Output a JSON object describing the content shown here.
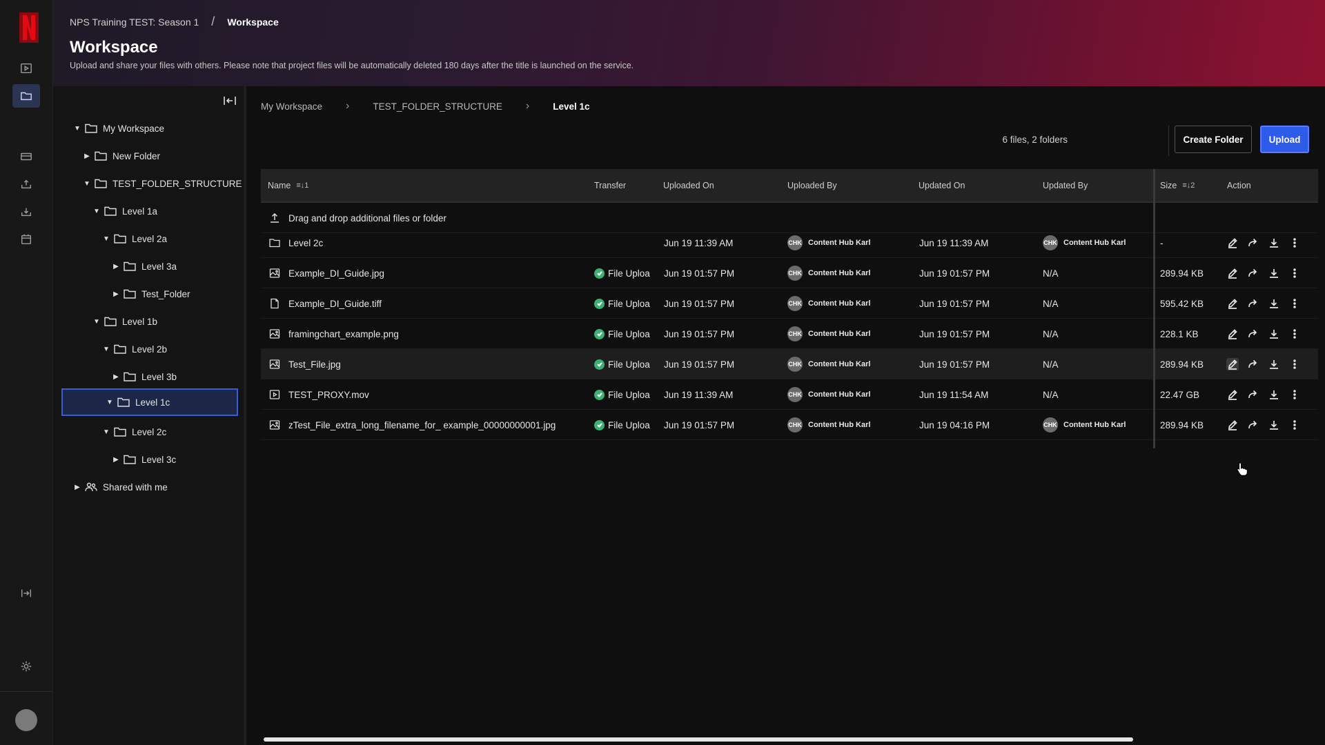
{
  "header": {
    "breadcrumb": [
      "NPS Training TEST: Season 1",
      "Workspace"
    ],
    "separator": "/",
    "title": "Workspace",
    "subtitle": "Upload and share your files with others. Please note that project files will be automatically deleted 180 days after the title is launched on the service."
  },
  "tree": {
    "items": [
      {
        "label": "My Workspace"
      },
      {
        "label": "New Folder"
      },
      {
        "label": "TEST_FOLDER_STRUCTURE"
      },
      {
        "label": "Level 1a"
      },
      {
        "label": "Level 2a"
      },
      {
        "label": "Level 3a"
      },
      {
        "label": "Test_Folder"
      },
      {
        "label": "Level 1b"
      },
      {
        "label": "Level 2b"
      },
      {
        "label": "Level 3b"
      },
      {
        "label": "Level 1c"
      },
      {
        "label": "Level 2c"
      },
      {
        "label": "Level 3c"
      },
      {
        "label": "Shared with me"
      }
    ]
  },
  "breadcrumb": [
    "My Workspace",
    "TEST_FOLDER_STRUCTURE",
    "Level 1c"
  ],
  "toolbar": {
    "counts": "6 files, 2 folders",
    "create_folder": "Create Folder",
    "upload": "Upload"
  },
  "table": {
    "columns": {
      "name": "Name",
      "name_sort": "1",
      "transfer": "Transfer",
      "uploaded_on": "Uploaded On",
      "uploaded_by": "Uploaded By",
      "updated_on": "Updated On",
      "updated_by": "Updated By",
      "size": "Size",
      "size_sort": "2",
      "action": "Action"
    },
    "dropzone": "Drag and drop additional files or folder",
    "user_initials": "CHK",
    "rows": [
      {
        "name": "Level 2c",
        "icon": "folder-icon",
        "transfer": "",
        "uploaded_on": "Jun 19 11:39 AM",
        "uploaded_by": "Content Hub Karl",
        "updated_on": "Jun 19 11:39 AM",
        "updated_by": "Content Hub Karl",
        "size": "-"
      },
      {
        "name": "Example_DI_Guide.jpg",
        "icon": "image-icon",
        "transfer": "File Uploa",
        "uploaded_on": "Jun 19 01:57 PM",
        "uploaded_by": "Content Hub Karl",
        "updated_on": "Jun 19 01:57 PM",
        "updated_by": "N/A",
        "size": "289.94 KB"
      },
      {
        "name": "Example_DI_Guide.tiff",
        "icon": "file-icon",
        "transfer": "File Uploa",
        "uploaded_on": "Jun 19 01:57 PM",
        "uploaded_by": "Content Hub Karl",
        "updated_on": "Jun 19 01:57 PM",
        "updated_by": "N/A",
        "size": "595.42 KB"
      },
      {
        "name": "framingchart_example.png",
        "icon": "image-icon",
        "transfer": "File Uploa",
        "uploaded_on": "Jun 19 01:57 PM",
        "uploaded_by": "Content Hub Karl",
        "updated_on": "Jun 19 01:57 PM",
        "updated_by": "N/A",
        "size": "228.1 KB"
      },
      {
        "name": "Test_File.jpg",
        "icon": "image-icon",
        "transfer": "File Uploa",
        "uploaded_on": "Jun 19 01:57 PM",
        "uploaded_by": "Content Hub Karl",
        "updated_on": "Jun 19 01:57 PM",
        "updated_by": "N/A",
        "size": "289.94 KB"
      },
      {
        "name": "TEST_PROXY.mov",
        "icon": "video-icon",
        "transfer": "File Uploa",
        "uploaded_on": "Jun 19 11:39 AM",
        "uploaded_by": "Content Hub Karl",
        "updated_on": "Jun 19 11:54 AM",
        "updated_by": "N/A",
        "size": "22.47 GB"
      },
      {
        "name": "zTest_File_extra_long_filename_for_ example_00000000001.jpg",
        "icon": "image-icon",
        "transfer": "File Uploa",
        "uploaded_on": "Jun 19 01:57 PM",
        "uploaded_by": "Content Hub Karl",
        "updated_on": "Jun 19 04:16 PM",
        "updated_by": "Content Hub Karl",
        "size": "289.94 KB"
      }
    ]
  },
  "colors": {
    "accent": "#2f5bea",
    "success": "#3bb273",
    "brand": "#e50914"
  }
}
